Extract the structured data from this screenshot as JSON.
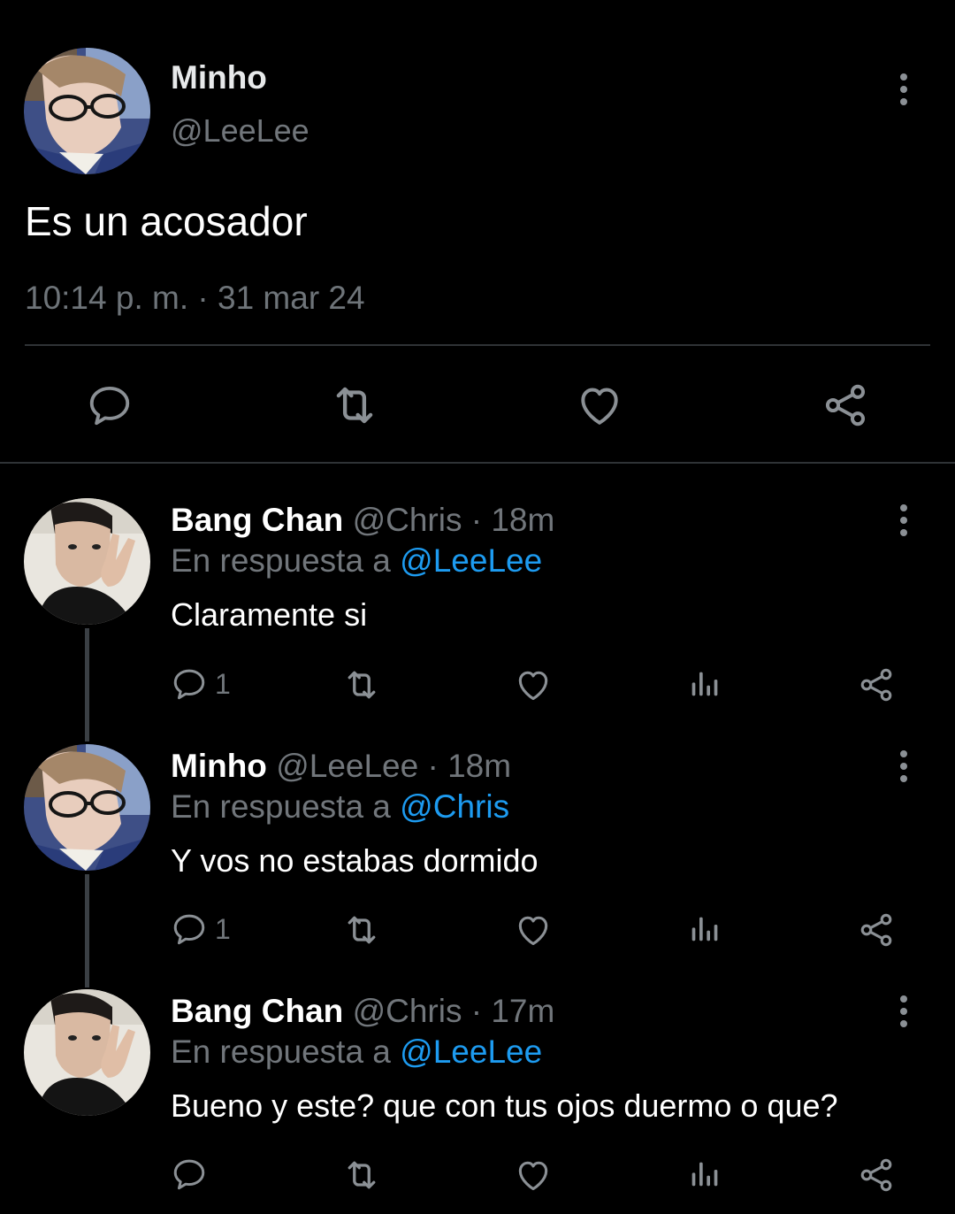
{
  "colors": {
    "background": "#000000",
    "text_primary": "#e7e9ea",
    "text_secondary": "#71767b",
    "mention": "#1d9bf0",
    "divider": "#2f3336"
  },
  "main_tweet": {
    "name": "Minho",
    "handle": "@LeeLee",
    "text": "Es un acosador",
    "timestamp": "10:14 p. m. · 31 mar 24",
    "actions": [
      "reply-icon",
      "retweet-icon",
      "like-icon",
      "share-icon"
    ]
  },
  "replies": [
    {
      "name": "Bang Chan",
      "handle": "@Chris",
      "separator": "·",
      "time": "18m",
      "reply_prefix": "En respuesta a",
      "reply_to": "@LeeLee",
      "text": "Claramente si",
      "reply_count": "1"
    },
    {
      "name": "Minho",
      "handle": "@LeeLee",
      "separator": "·",
      "time": "18m",
      "reply_prefix": "En respuesta a",
      "reply_to": "@Chris",
      "text": "Y vos no estabas dormido",
      "reply_count": "1"
    },
    {
      "name": "Bang Chan",
      "handle": "@Chris",
      "separator": "·",
      "time": "17m",
      "reply_prefix": "En respuesta a",
      "reply_to": "@LeeLee",
      "text": "Bueno y este? que con tus ojos duermo o que?",
      "reply_count": ""
    }
  ]
}
